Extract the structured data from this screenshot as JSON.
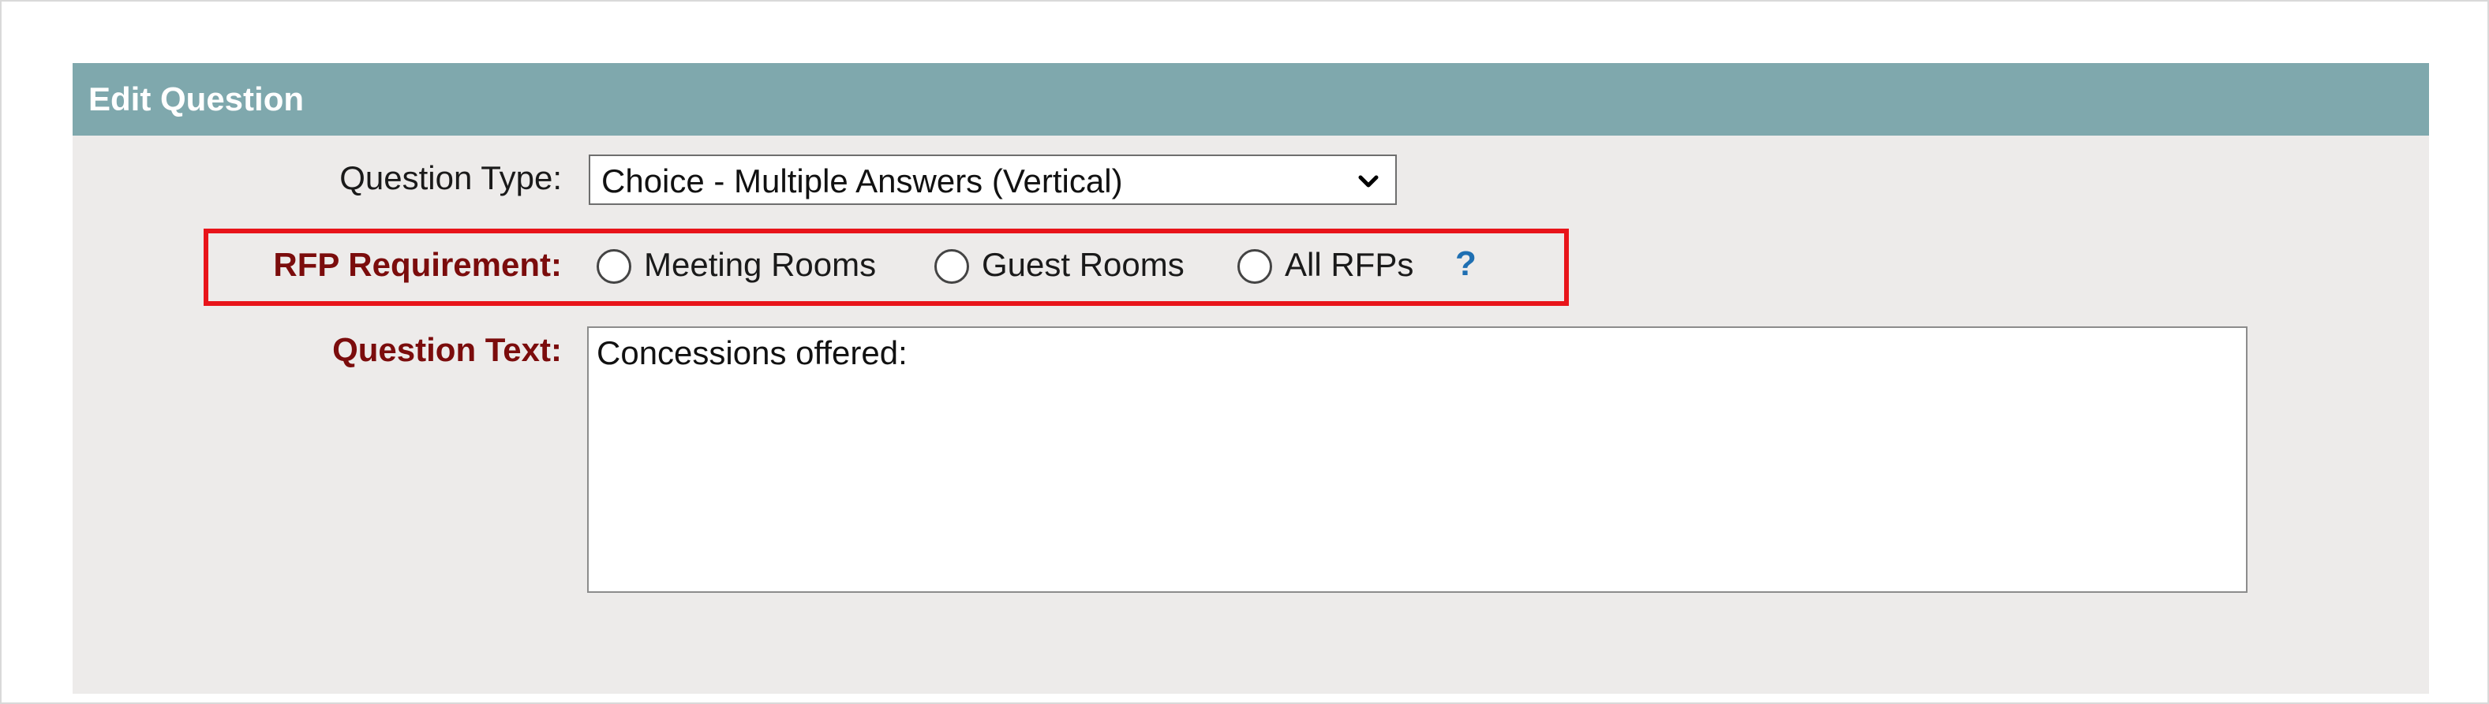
{
  "panel": {
    "title": "Edit Question"
  },
  "question_type": {
    "label": "Question Type:",
    "selected": "Choice - Multiple Answers (Vertical)"
  },
  "rfp_requirement": {
    "label": "RFP Requirement:",
    "options": [
      "Meeting Rooms",
      "Guest Rooms",
      "All RFPs"
    ],
    "help_symbol": "?"
  },
  "question_text": {
    "label": "Question Text:",
    "value": "Concessions offered:"
  },
  "colors": {
    "header": "#7fa8ad",
    "panel_bg": "#edebea",
    "required_label": "#7b0c0c",
    "highlight": "#e8141a",
    "help": "#1f6fb2"
  },
  "icons": {
    "dropdown": "chevron-down-icon",
    "help": "help-icon"
  }
}
